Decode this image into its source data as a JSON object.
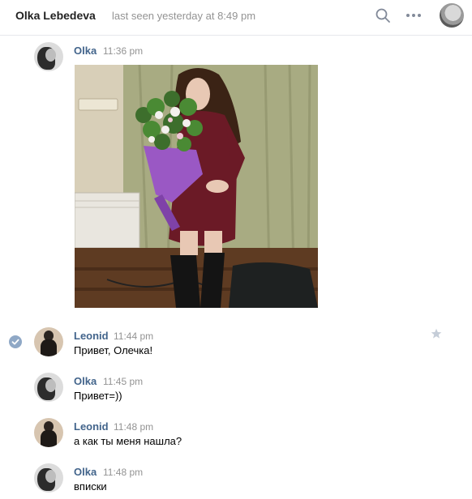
{
  "header": {
    "name": "Olka Lebedeva",
    "status": "last seen yesterday at 8:49 pm"
  },
  "messages": [
    {
      "author": "Olka",
      "time": "11:36 pm",
      "text": "",
      "has_photo": true
    },
    {
      "author": "Leonid",
      "time": "11:44 pm",
      "text": "Привет, Олечка!",
      "read": true,
      "starred": false
    },
    {
      "author": "Olka",
      "time": "11:45 pm",
      "text": "Привет=))"
    },
    {
      "author": "Leonid",
      "time": "11:48 pm",
      "text": "а как ты меня нашла?"
    },
    {
      "author": "Olka",
      "time": "11:48 pm",
      "text": "вписки"
    }
  ],
  "icons": {
    "search": "search-icon",
    "more": "more-dots-icon",
    "read": "check-circle-icon",
    "star": "star-icon"
  },
  "colors": {
    "author_link": "#42648b",
    "meta_gray": "#939393",
    "read_badge": "#8fa8c6"
  }
}
